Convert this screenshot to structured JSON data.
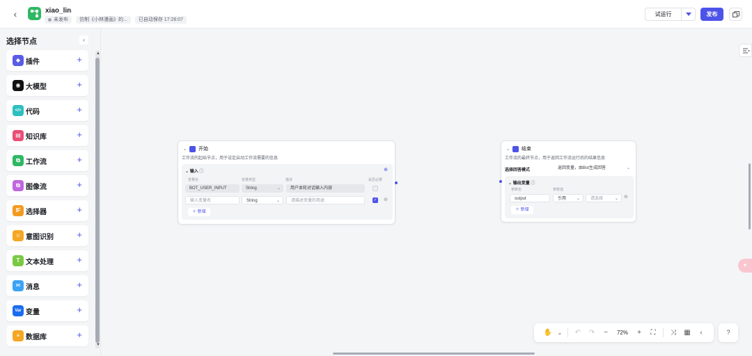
{
  "header": {
    "app_name": "xiao_lin",
    "status": "未发布",
    "copied_from": "仿制《小林漫画》的...",
    "autosave": "已自动保存 17:28:07",
    "trial_label": "试运行",
    "publish_label": "发布"
  },
  "sidebar": {
    "title": "选择节点",
    "items": [
      {
        "label": "插件",
        "color": "#5b5ce6",
        "glyph": "◆"
      },
      {
        "label": "大模型",
        "color": "#111111",
        "glyph": "◉"
      },
      {
        "label": "代码",
        "color": "#2cbfbf",
        "glyph": "</>"
      },
      {
        "label": "知识库",
        "color": "#e94e77",
        "glyph": "▤"
      },
      {
        "label": "工作流",
        "color": "#2fb864",
        "glyph": "⧉"
      },
      {
        "label": "图像流",
        "color": "#c066e0",
        "glyph": "⧉"
      },
      {
        "label": "选择器",
        "color": "#f39a1f",
        "glyph": "IF"
      },
      {
        "label": "意图识别",
        "color": "#f5a623",
        "glyph": "☺"
      },
      {
        "label": "文本处理",
        "color": "#7ac943",
        "glyph": "T"
      },
      {
        "label": "消息",
        "color": "#3aa3f5",
        "glyph": "✉"
      },
      {
        "label": "变量",
        "color": "#1a6cf0",
        "glyph": "Var"
      },
      {
        "label": "数据库",
        "color": "#f5a623",
        "glyph": "≡"
      }
    ]
  },
  "start_node": {
    "title": "开始",
    "desc": "工作流的起始节点，用于设定启动工作流需要的信息",
    "section": "输入",
    "col_name": "变量名",
    "col_type": "变量类型",
    "col_desc": "描述",
    "col_required": "是否必要",
    "row1_name": "BOT_USER_INPUT",
    "row1_type": "String",
    "row1_desc": "用户本轮对话输入内容",
    "row2_name_placeholder": "输入变量名",
    "row2_type": "String",
    "row2_desc_placeholder": "请描述变量的用途",
    "add_label": "新增"
  },
  "end_node": {
    "title": "结束",
    "desc": "工作流的最终节点，用于返回工作流运行后的结果信息",
    "mode_label": "选择回答模式",
    "mode_value": "返回变量，由Bot生成回答",
    "section": "输出变量",
    "col_name": "参数名",
    "col_value": "参数值",
    "row_name": "output",
    "row_ref": "引用",
    "row_select_placeholder": "请选择",
    "add_label": "新增"
  },
  "toolbar": {
    "zoom": "72%"
  }
}
